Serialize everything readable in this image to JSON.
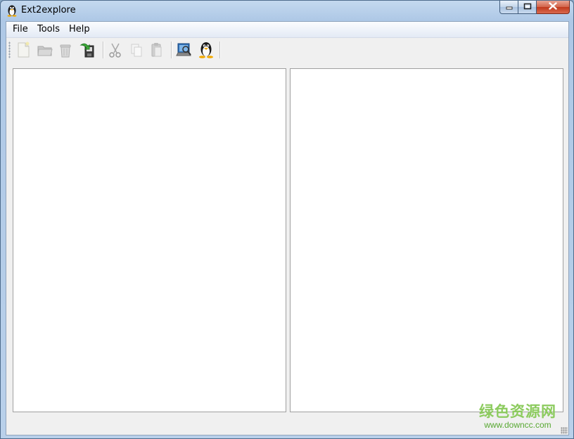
{
  "window": {
    "title": "Ext2explore",
    "controls": {
      "minimize": "—",
      "maximize": "▢",
      "close": "✕"
    }
  },
  "menu": {
    "items": [
      {
        "label": "File"
      },
      {
        "label": "Tools"
      },
      {
        "label": "Help"
      }
    ]
  },
  "toolbar": {
    "buttons": [
      {
        "icon": "new-file-icon",
        "enabled": false
      },
      {
        "icon": "folder-icon",
        "enabled": false
      },
      {
        "icon": "trash-icon",
        "enabled": false
      },
      {
        "icon": "save-export-icon",
        "enabled": true
      },
      {
        "icon": "cut-icon",
        "enabled": false
      },
      {
        "icon": "copy-icon",
        "enabled": false
      },
      {
        "icon": "paste-icon",
        "enabled": false
      },
      {
        "icon": "rescan-drive-icon",
        "enabled": true
      },
      {
        "icon": "linux-tux-icon",
        "enabled": true
      }
    ]
  },
  "watermark": {
    "cn": "绿色资源网",
    "url": "www.downcc.com"
  }
}
